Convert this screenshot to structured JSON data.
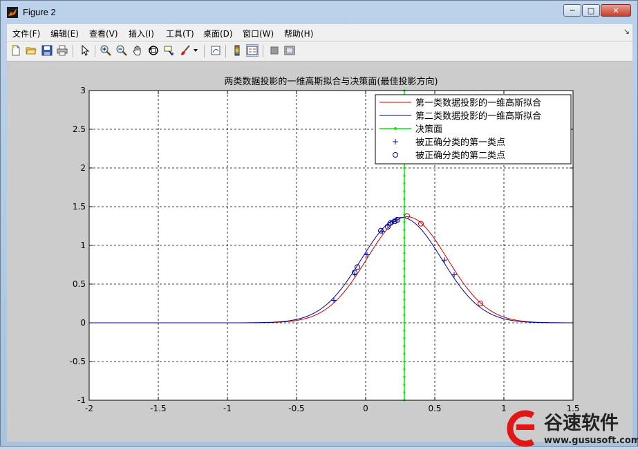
{
  "window": {
    "title": "Figure 2",
    "controls": {
      "minimize": "─",
      "maximize": "□",
      "close": "✕"
    }
  },
  "menu": [
    "文件(F)",
    "编辑(E)",
    "查看(V)",
    "插入(I)",
    "工具(T)",
    "桌面(D)",
    "窗口(W)",
    "帮助(H)"
  ],
  "menu_dock_arrow": "↘",
  "toolbar": [
    "new-file",
    "open-folder",
    "save",
    "print",
    "pointer",
    "zoom-in",
    "zoom-out",
    "pan-hand",
    "rotate-3d",
    "data-cursor",
    "brush",
    "brush-dropdown",
    "link-plot",
    "colorbar",
    "legend",
    "hide-plot-tools",
    "show-plot-tools"
  ],
  "colors": {
    "class1": "#cc0000",
    "class2": "#000099",
    "decision": "#00ee00",
    "axes_bg": "#ffffff",
    "figure_bg": "#cccccc"
  },
  "chart_data": {
    "type": "line",
    "title": "两类数据投影的一维高斯拟合与决策面(最佳投影方向)",
    "xlabel": "",
    "ylabel": "",
    "xlim": [
      -2,
      1.5
    ],
    "ylim": [
      -1,
      3
    ],
    "xticks": [
      -2,
      -1.5,
      -1,
      -0.5,
      0,
      0.5,
      1,
      1.5
    ],
    "yticks": [
      -1,
      -0.5,
      0,
      0.5,
      1,
      1.5,
      2,
      2.5,
      3
    ],
    "xtick_labels": [
      "-2",
      "-1.5",
      "-1",
      "-0.5",
      "0",
      "0.5",
      "1",
      "1.5"
    ],
    "ytick_labels": [
      "-1",
      "-0.5",
      "0",
      "0.5",
      "1",
      "1.5",
      "2",
      "2.5",
      "3"
    ],
    "grid": true,
    "legend_position": "top-right",
    "series": [
      {
        "name": "第一类数据投影的一维高斯拟合",
        "kind": "gaussian",
        "mean": 0.3,
        "peak": 1.37,
        "sigma": 0.29,
        "color": "#cc0000"
      },
      {
        "name": "第二类数据投影的一维高斯拟合",
        "kind": "gaussian",
        "mean": 0.26,
        "peak": 1.36,
        "sigma": 0.29,
        "color": "#000099"
      },
      {
        "name": "决策面",
        "kind": "vline",
        "x": 0.28,
        "color": "#00ee00"
      },
      {
        "name": "被正确分类的第一类点",
        "kind": "points",
        "marker": "plus",
        "color": "#000099",
        "x": [
          -0.23,
          -0.08,
          0.01,
          0.12,
          0.16,
          0.18,
          0.2,
          0.22,
          0.57,
          0.64
        ],
        "y": [
          0.29,
          0.63,
          0.88,
          1.18,
          1.26,
          1.29,
          1.31,
          1.33,
          0.81,
          0.62
        ]
      },
      {
        "name": "被正确分类的第二类点",
        "kind": "points",
        "marker": "circle",
        "color": "#000099",
        "x": [
          -0.08,
          -0.06,
          0.11,
          0.16,
          0.18,
          0.21,
          0.23,
          0.3,
          0.4,
          0.83
        ],
        "y": [
          0.65,
          0.72,
          1.19,
          1.24,
          1.29,
          1.31,
          1.33,
          1.38,
          1.28,
          0.25
        ],
        "circle_colors": [
          "#000099",
          "#000099",
          "#000099",
          "#000099",
          "#000099",
          "#000099",
          "#000099",
          "#cc0000",
          "#cc0000",
          "#cc0000"
        ]
      }
    ]
  },
  "watermark": {
    "brand": "谷速软件",
    "url": "www.gususoft.com"
  }
}
